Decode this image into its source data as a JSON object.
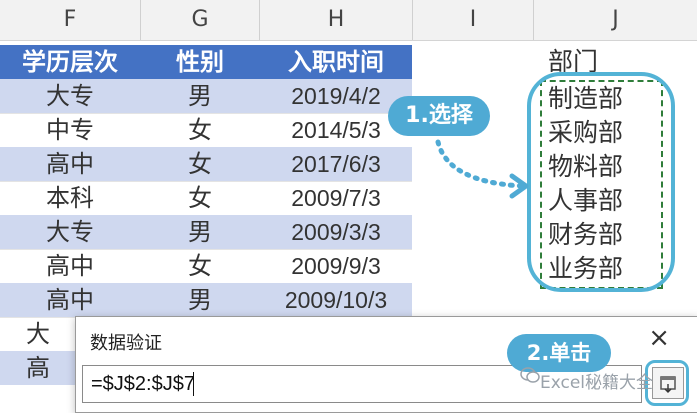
{
  "columns": [
    "F",
    "G",
    "H",
    "I",
    "J"
  ],
  "table": {
    "headers": [
      "学历层次",
      "性别",
      "入职时间"
    ],
    "rows": [
      [
        "大专",
        "男",
        "2019/4/2"
      ],
      [
        "中专",
        "女",
        "2014/5/3"
      ],
      [
        "高中",
        "女",
        "2017/6/3"
      ],
      [
        "本科",
        "女",
        "2009/7/3"
      ],
      [
        "大专",
        "男",
        "2009/3/3"
      ],
      [
        "高中",
        "女",
        "2009/9/3"
      ],
      [
        "高中",
        "男",
        "2009/10/3"
      ],
      [
        "大",
        "",
        ""
      ],
      [
        "高",
        "",
        ""
      ]
    ]
  },
  "departments": {
    "header": "部门",
    "items": [
      "制造部",
      "采购部",
      "物料部",
      "人事部",
      "财务部",
      "业务部"
    ]
  },
  "callouts": {
    "step1": "1.选择",
    "step2": "2.单击"
  },
  "dialog": {
    "title": "数据验证",
    "close": "×",
    "formula": "=$J$2:$J$7"
  },
  "watermark": "Excel秘籍大全",
  "colors": {
    "header_fill": "#4472c4",
    "band_fill": "#cfd8ef",
    "accent": "#4faad4",
    "marquee": "#2f7d3a"
  }
}
